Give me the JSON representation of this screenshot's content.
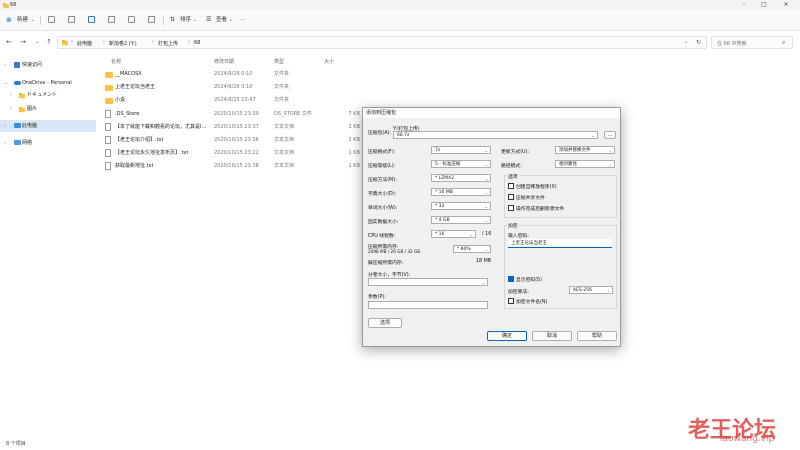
{
  "window": {
    "title": "68"
  },
  "toolbar": {
    "new_label": "新建",
    "sort_label": "排序",
    "view_label": "查看",
    "more": "···"
  },
  "address": {
    "path": [
      "此电脑",
      "新加卷2 (Y:)",
      "打包上传",
      "68"
    ],
    "search_placeholder": "在 68 中搜索"
  },
  "sidebar": {
    "items": [
      {
        "label": "快速访问",
        "arrow": "›",
        "icon": "star-icon"
      },
      {
        "label": "OneDrive - Personal",
        "arrow": "⌄",
        "icon": "cloud-icon"
      },
      {
        "label": "ドキュメント",
        "arrow": "›",
        "icon": "folder-icon"
      },
      {
        "label": "图片",
        "arrow": "›",
        "icon": "folder-icon"
      },
      {
        "label": "此电脑",
        "arrow": "›",
        "icon": "pc-icon"
      },
      {
        "label": "网络",
        "arrow": "›",
        "icon": "network-icon"
      }
    ]
  },
  "columns": {
    "name": "名称",
    "date": "修改日期",
    "type": "类型",
    "size": "大小"
  },
  "files": [
    {
      "name": "__MACOSX",
      "date": "2024/9/26 0:10",
      "type": "文件夹",
      "size": "",
      "kind": "folder"
    },
    {
      "name": "上老王论坛当老王",
      "date": "2024/9/26 0:10",
      "type": "文件夹",
      "size": "",
      "kind": "folder"
    },
    {
      "name": "小说",
      "date": "2024/9/25 23:47",
      "type": "文件夹",
      "size": "",
      "kind": "folder"
    },
    {
      "name": ".DS_Store",
      "date": "2020/10/15 23:39",
      "type": "DS_STORE 文件",
      "size": "7 KB",
      "kind": "file"
    },
    {
      "name": "【本了就能下載和觀看的论坛，尤其是I…",
      "date": "2020/10/15 23:37",
      "type": "文本文档",
      "size": "2 KB",
      "kind": "file"
    },
    {
      "name": "【老王论坛介绍】.txt",
      "date": "2020/10/15 23:36",
      "type": "文本文档",
      "size": "2 KB",
      "kind": "file"
    },
    {
      "name": "【老王论坛永久地址发布页】.txt",
      "date": "2020/10/15 23:22",
      "type": "文本文档",
      "size": "1 KB",
      "kind": "file"
    },
    {
      "name": "获取最新地址.txt",
      "date": "2020/10/15 23:38",
      "type": "文本文档",
      "size": "1 KB",
      "kind": "file"
    }
  ],
  "status": {
    "count": "8 个项目"
  },
  "dialog": {
    "title": "添加到压缩包",
    "archive_label": "压缩包(A):",
    "archive_path": "Y:\\打包上传\\",
    "archive_name": "68.7z",
    "browse": "...",
    "format_label": "压缩格式(F):",
    "format_value": "7z",
    "level_label": "压缩等级(L):",
    "level_value": "5 - 标准压缩",
    "method_label": "压缩方法(M):",
    "method_value": "* LZMA2",
    "dict_label": "字典大小(D):",
    "dict_value": "* 16 MB",
    "word_label": "单词大小(W):",
    "word_value": "* 32",
    "solid_label": "固实数据大小:",
    "solid_value": "* 4 GB",
    "cpu_label": "CPU 线程数:",
    "cpu_value": "* 16",
    "cpu_total": "/ 16",
    "mem_label": "压缩所需内存:",
    "mem_detail": "2498 MB / 26 GB / 32 GB",
    "mem_value": "* 80%",
    "decomp_label": "解压缩所需内存:",
    "decomp_value": "18 MB",
    "split_label": "分卷大小，字节(V):",
    "params_label": "参数(P):",
    "options_btn": "选项",
    "update_label": "更新方式(U):",
    "update_value": "添加并替换文件",
    "pathmode_label": "路径模式:",
    "pathmode_value": "相对路径",
    "opts_group": "选项",
    "opt_sfx": "创建自释放程序(X)",
    "opt_shared": "压缩共享文件",
    "opt_delete": "操作完成后删除源文件",
    "enc_group": "加密",
    "pwd_label": "输入密码:",
    "pwd_value": "上老王论坛当老王",
    "show_pwd": "显示密码(S)",
    "enc_method_label": "加密算法:",
    "enc_method_value": "AES-256",
    "enc_names": "加密文件名(N)",
    "ok": "确定",
    "cancel": "取消",
    "help": "帮助"
  },
  "watermark": {
    "cn": "老王论坛",
    "en": "laowang.vip"
  }
}
